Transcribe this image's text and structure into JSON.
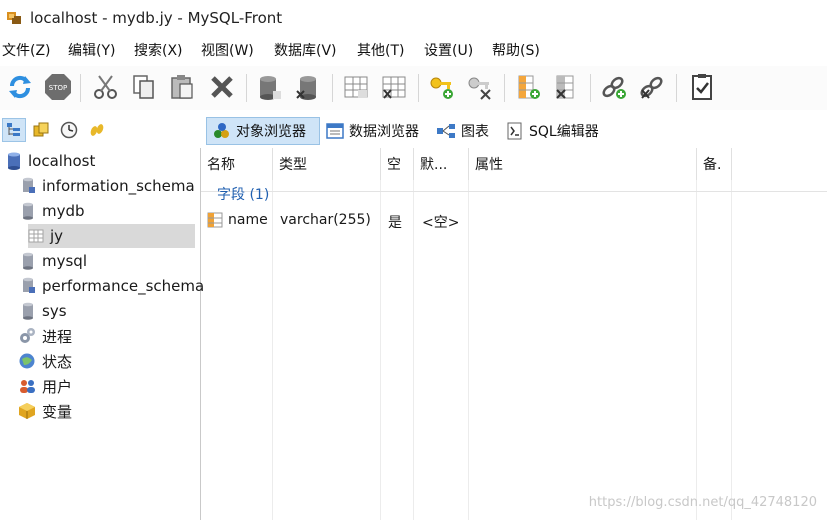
{
  "window": {
    "title": "localhost - mydb.jy - MySQL-Front"
  },
  "menu": [
    "文件(Z)",
    "编辑(Y)",
    "搜索(X)",
    "视图(W)",
    "数据库(V)",
    "其他(T)",
    "设置(U)",
    "帮助(S)"
  ],
  "right_tabs": [
    {
      "label": "对象浏览器",
      "active": true
    },
    {
      "label": "数据浏览器",
      "active": false
    },
    {
      "label": "图表",
      "active": false
    },
    {
      "label": "SQL编辑器",
      "active": false
    }
  ],
  "tree": [
    {
      "label": "localhost",
      "icon": "server-icon",
      "level": 0,
      "selected": false
    },
    {
      "label": "information_schema",
      "icon": "system-database-icon",
      "level": 1,
      "selected": false
    },
    {
      "label": "mydb",
      "icon": "database-icon",
      "level": 1,
      "selected": false
    },
    {
      "label": "jy",
      "icon": "table-icon",
      "level": 2,
      "selected": true
    },
    {
      "label": "mysql",
      "icon": "database-icon",
      "level": 1,
      "selected": false
    },
    {
      "label": "performance_schema",
      "icon": "system-database-icon",
      "level": 1,
      "selected": false
    },
    {
      "label": "sys",
      "icon": "database-icon",
      "level": 1,
      "selected": false
    },
    {
      "label": "进程",
      "icon": "processes-icon",
      "level": 1,
      "selected": false
    },
    {
      "label": "状态",
      "icon": "status-icon",
      "level": 1,
      "selected": false
    },
    {
      "label": "用户",
      "icon": "users-icon",
      "level": 1,
      "selected": false
    },
    {
      "label": "变量",
      "icon": "variables-icon",
      "level": 1,
      "selected": false
    }
  ],
  "columns": [
    "名称",
    "类型",
    "空",
    "默...",
    "属性",
    "备."
  ],
  "group": {
    "label": "字段 (1)"
  },
  "rows": [
    {
      "name": "name",
      "type": "varchar(255)",
      "null": "是",
      "default": "<空>",
      "attributes": "",
      "comment": ""
    }
  ],
  "watermark": "https://blog.csdn.net/qq_42748120"
}
